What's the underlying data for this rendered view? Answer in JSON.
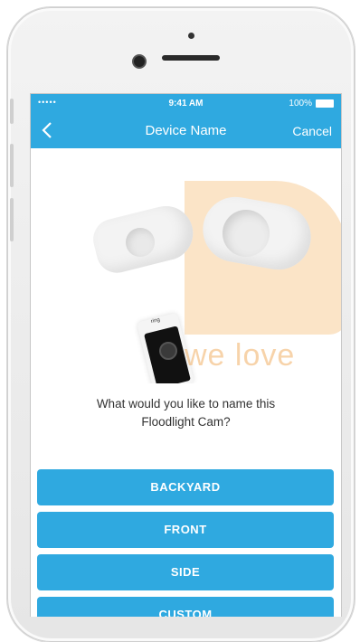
{
  "status_bar": {
    "signal": "•••••",
    "time": "9:41 AM",
    "battery": "100%"
  },
  "nav": {
    "back_icon": "chevron-left-icon",
    "title": "Device Name",
    "cancel": "Cancel"
  },
  "illustration": {
    "brand": "ring",
    "watermark": "we love"
  },
  "prompt": {
    "line1": "What would you like to name this",
    "line2": "Floodlight Cam?"
  },
  "choices": [
    {
      "label": "BACKYARD"
    },
    {
      "label": "FRONT"
    },
    {
      "label": "SIDE"
    },
    {
      "label": "CUSTOM"
    }
  ],
  "colors": {
    "accent": "#2fa9e0",
    "watermark": "#f6c482"
  }
}
